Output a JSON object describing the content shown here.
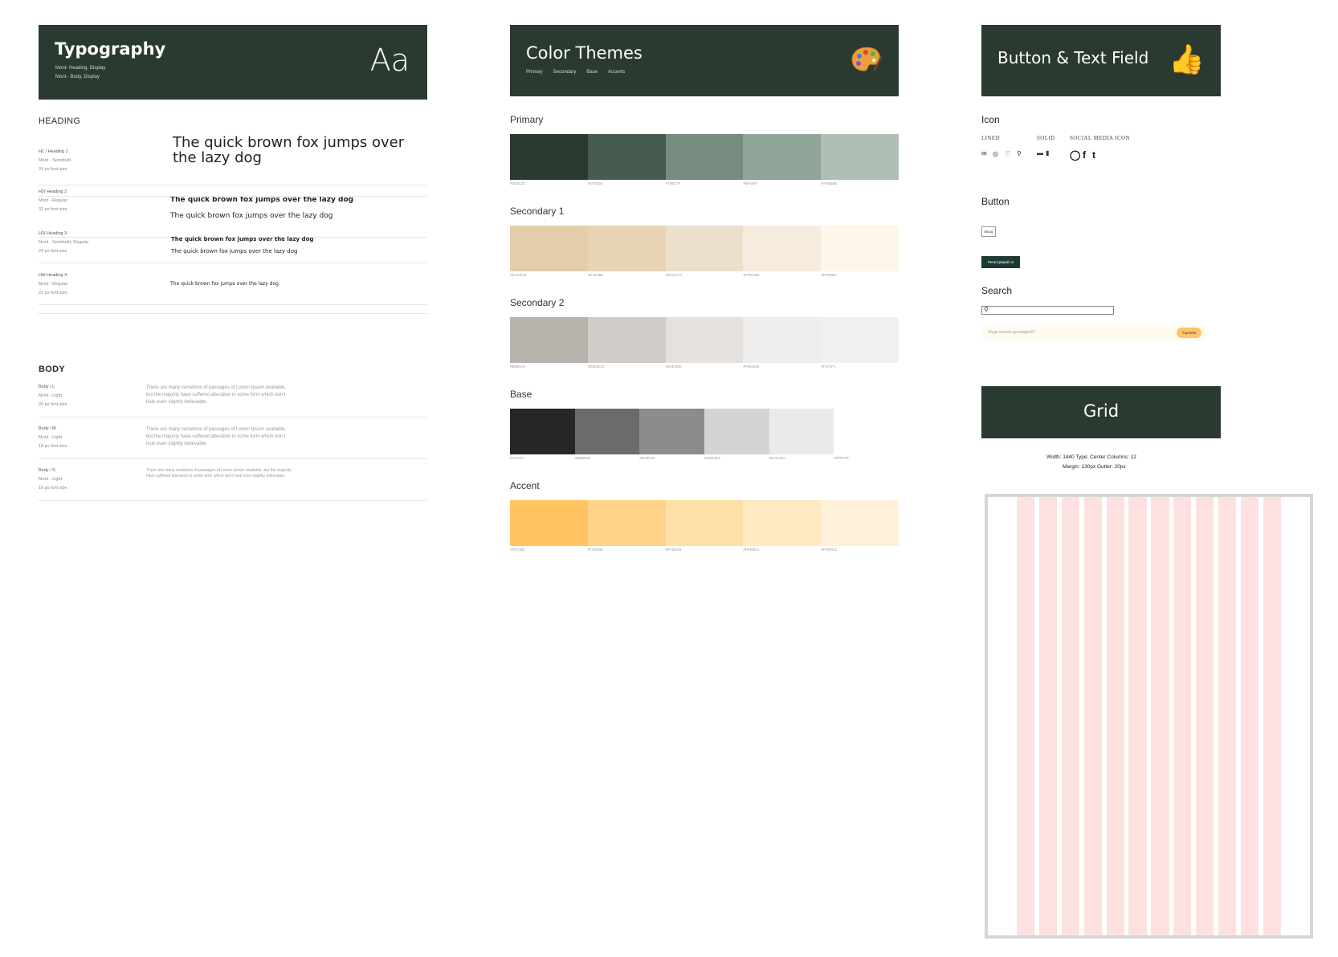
{
  "typography": {
    "title": "Typography",
    "sub1": "Mont- Heading, Display",
    "sub2": "Mont - Body, Display",
    "aa": "Aa",
    "heading_label": "HEADING",
    "body_label": "BODY",
    "headings": [
      {
        "name": "H1 / Heading 1",
        "font": "Mont - Semibold",
        "size": "24 px font size",
        "samples": [
          "The quick brown fox jumps over the lazy dog"
        ]
      },
      {
        "name": "H2/ Heading 2",
        "font": "Mont - Regular",
        "size": "32 px font size",
        "samples": [
          "The quick brown fox jumps over the lazy dog",
          "The quick brown fox jumps over the lazy dog"
        ]
      },
      {
        "name": "H3/ Heading 3",
        "font": "Mont - Semibold, Regular",
        "size": "24 px font size",
        "samples": [
          "The quick brown fox jumps over the lazy dog",
          "The quick brown fox jumps over the lazy dog"
        ]
      },
      {
        "name": "H4/ Heading 4",
        "font": "Mont - Regular",
        "size": "22 px font size",
        "samples": [
          "The quick brown fox jumps over the lazy dog"
        ]
      }
    ],
    "bodies": [
      {
        "name": "Body / L",
        "font": "Mont - Light",
        "size": "20 px font size",
        "text": "There are many variations of passages of Lorem Ipsum available, but the majority have suffered alteration in some form which don't look even slightly believable."
      },
      {
        "name": "Body / M",
        "font": "Mont - Light",
        "size": "18 px font size",
        "text": "There are many variations of passages of Lorem Ipsum available, but the majority have suffered alteration in some form which don't look even slightly believable."
      },
      {
        "name": "Body / S",
        "font": "Mont - Light",
        "size": "16 px font size",
        "text": "There are many variations of passages of Lorem Ipsum available, but the majority have suffered alteration in some form which don't look even slightly believable."
      }
    ]
  },
  "colors": {
    "title": "Color Themes",
    "tabs": [
      "Primary",
      "Secondary",
      "Base",
      "Accents"
    ],
    "palette_icon": "palette-icon",
    "palettes": [
      {
        "name": "Primary",
        "colors": [
          "#2B3A30",
          "#475C50",
          "#758C7F",
          "#8FA597",
          "#AFBEB5"
        ],
        "labels": [
          "#2B3C33",
          "#475C5E",
          "#758C7F",
          "#8FA597",
          "#AFBEB5"
        ]
      },
      {
        "name": "Secondary 1",
        "colors": [
          "#E4CEA9",
          "#E8D4B5",
          "#ECDFCB",
          "#F6ECDE",
          "#FDF6EA"
        ],
        "labels": [
          "#EACEA9",
          "#E7D4B8",
          "#ECDFCA",
          "#F7ECDE",
          "#FDF6E0"
        ]
      },
      {
        "name": "Secondary 2",
        "colors": [
          "#B8B4AD",
          "#D0CCC7",
          "#E4E1DE",
          "#EEEDEB",
          "#F2F1F0"
        ],
        "labels": [
          "#B8B1A0",
          "#D0CBC8",
          "#E4E2DE",
          "#F0EEEB",
          "#F3F1F1"
        ]
      },
      {
        "name": "Base",
        "colors": [
          "#272727",
          "#6B6B6B",
          "#8C8C8C",
          "#D4D4D4",
          "#EAEAEA",
          "#FFFFFF"
        ],
        "labels": [
          "#272727",
          "#6B6B6B",
          "#8C8C8C",
          "#D4D4D4",
          "#EAEAEA",
          "#FFFFFF"
        ]
      },
      {
        "name": "Accent",
        "colors": [
          "#FFC562",
          "#FED389",
          "#FEDFA6",
          "#FEE9C0",
          "#FFF1D9"
        ],
        "labels": [
          "#FFC462",
          "#FFD389",
          "#FFDEA6",
          "#FEE9C0",
          "#FFEED2"
        ]
      }
    ]
  },
  "components": {
    "title": "Button & Text Field",
    "thumb_icon": "thumbs-up-icon",
    "icon_label": "Icon",
    "icon_categories": [
      "Lined",
      "Solid",
      "Social Media Icon"
    ],
    "button_label": "Button",
    "btn_outline": "Вход",
    "btn_filled": "Регистрирай се",
    "search_label": "Search",
    "search_placeholder": "Къде искате да отидете?",
    "search_button": "Търсене"
  },
  "grid": {
    "title": "Grid",
    "line1": "Width: 1440    Type: Center    Columns: 12",
    "line2": "Margin: 130px    Gutter: 20px",
    "columns": 12
  }
}
